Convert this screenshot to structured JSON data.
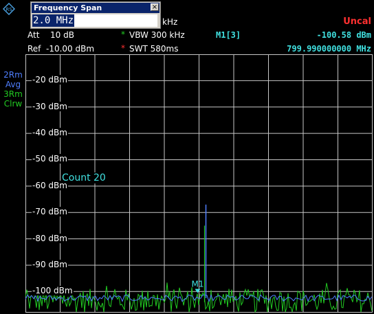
{
  "dialog": {
    "title": "Frequency Span",
    "close": "×",
    "value": "2.0 MHz"
  },
  "header": {
    "rbw_unit": "kHz",
    "att_label": "Att",
    "att_value": "10 dB",
    "ref_label": "Ref",
    "ref_value": "-10.00 dBm",
    "vbw_label": "VBW 300 kHz",
    "swt_label": "SWT 580ms",
    "uncal": "Uncal",
    "marker_name": "M1[3]",
    "marker_level": "-100.58 dBm",
    "marker_freq": "799.990000000 MHz"
  },
  "traces": [
    {
      "line1": "2Rm",
      "line2": "Avg",
      "color": "#4f7fff"
    },
    {
      "line1": "3Rm",
      "line2": "Clrw",
      "color": "#22cc22"
    }
  ],
  "count_text": "Count 20",
  "marker_label": "M1",
  "colors": {
    "trace2": "#4f7fff",
    "trace3": "#22cc22",
    "uncal": "#ff3030",
    "marker": "#40e0e0"
  },
  "chart_data": {
    "type": "line",
    "ylabel": "",
    "y_unit": "dBm",
    "y_ticks": [
      "-20 dBm",
      "-30 dBm",
      "-40 dBm",
      "-50 dBm",
      "-60 dBm",
      "-70 dBm",
      "-80 dBm",
      "-90 dBm",
      "-100 dBm"
    ],
    "y_tick_values": [
      -20,
      -30,
      -40,
      -50,
      -60,
      -70,
      -80,
      -90,
      -100
    ],
    "ylim": [
      -108,
      -10
    ],
    "x_divisions": 10,
    "center_freq_mhz": 800.0,
    "span_mhz": 2.0,
    "grid": true,
    "series": [
      {
        "name": "2Rm Avg",
        "noise_floor_dbm": -102.5,
        "peak_x_mhz": 800.0,
        "peak_dbm": -67
      },
      {
        "name": "3Rm Clrw",
        "noise_floor_dbm": -104,
        "noise_max_dbm": -99,
        "peak_x_mhz": 800.0,
        "peak_dbm": -75
      }
    ],
    "marker": {
      "name": "M1",
      "x_mhz": 799.99,
      "y_dbm": -100.58
    }
  }
}
